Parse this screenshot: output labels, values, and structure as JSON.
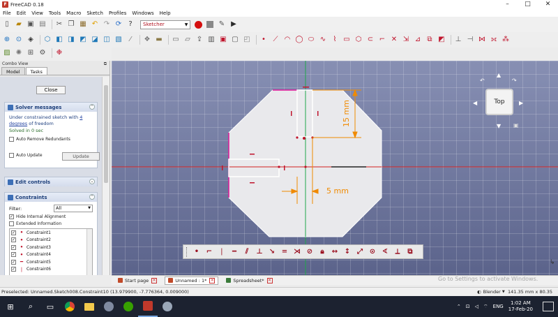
{
  "window": {
    "title": "FreeCAD 0.18",
    "controls": [
      "–",
      "□",
      "✕"
    ]
  },
  "menu": [
    "File",
    "Edit",
    "View",
    "Tools",
    "Macro",
    "Sketch",
    "Profiles",
    "Windows",
    "Help"
  ],
  "toolbar": {
    "workbench": "Sketcher"
  },
  "combo": {
    "title": "Combo View",
    "tabs": [
      "Model",
      "Tasks"
    ],
    "close_label": "Close",
    "solver": {
      "header": "Solver messages",
      "message_prefix": "Under constrained sketch with ",
      "message_link": "4 degrees",
      "message_suffix": " of freedom",
      "solved": "Solved in 0 sec",
      "auto_remove": "Auto Remove Redundants",
      "auto_update": "Auto Update",
      "update_label": "Update"
    },
    "edit_controls": {
      "header": "Edit controls"
    },
    "constraints": {
      "header": "Constraints",
      "filter_label": "Filter:",
      "filter_value": "All",
      "hide_internal": "Hide Internal Alignment",
      "extended_info": "Extended Information",
      "items": [
        "Constraint1",
        "Constraint2",
        "Constraint3",
        "Constraint4",
        "Constraint5",
        "Constraint6"
      ]
    }
  },
  "viewport": {
    "navcube_face": "Top",
    "dim_vertical": "15 mm",
    "dim_horizontal": "5 mm"
  },
  "doc_tabs": [
    "Start page",
    "Unnamed : 1*",
    "Spreadsheet*"
  ],
  "watermark": "Go to Settings to activate Windows.",
  "status": {
    "preselected": "Preselected: Unnamed.Sketch008.Constraint10 (13.979900, -7.776364, 0.009000)",
    "nav_style": "Blender",
    "dimensions": "141.35 mm x 80.35 mm"
  },
  "taskbar": {
    "lang": "ENG",
    "time": "1:02 AM",
    "date": "17-Feb-20"
  },
  "colors": {
    "accent_red": "#c0142c",
    "dimension": "#f08a00",
    "viewport_bg": "#6f779f"
  }
}
